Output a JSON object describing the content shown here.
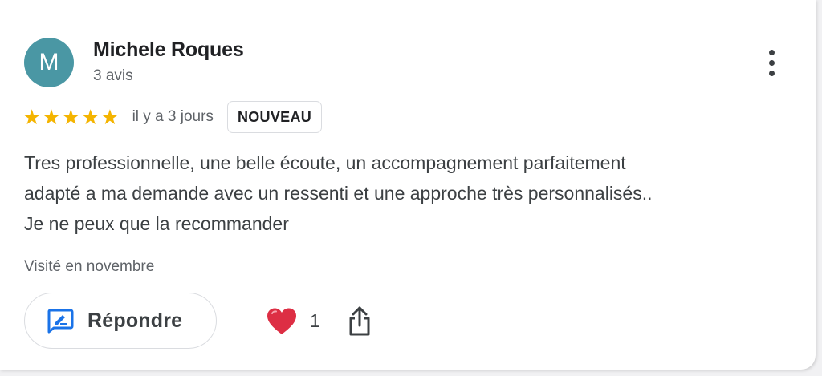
{
  "colors": {
    "avatar_bg": "#4a97a4",
    "star": "#f4b400",
    "reply_icon": "#1a73e8",
    "heart": "#dd2e44"
  },
  "review": {
    "author": {
      "initial": "M",
      "name": "Michele Roques",
      "review_count": "3 avis"
    },
    "rating": 5,
    "stars": [
      "★",
      "★",
      "★",
      "★",
      "★"
    ],
    "date": "il y a 3 jours",
    "badge": "NOUVEAU",
    "text_lines": [
      "Tres professionnelle, une belle écoute, un accompagnement parfaitement",
      "adapté a ma demande avec un ressenti et une approche très personnalisés..",
      "Je ne peux que la recommander"
    ],
    "visited": "Visité en novembre",
    "actions": {
      "reply_label": "Répondre",
      "reply_icon": "reply-feedback-icon",
      "like_icon": "heart-icon",
      "like_count": "1",
      "share_icon": "share-icon",
      "menu_icon": "more-vert-icon"
    }
  }
}
